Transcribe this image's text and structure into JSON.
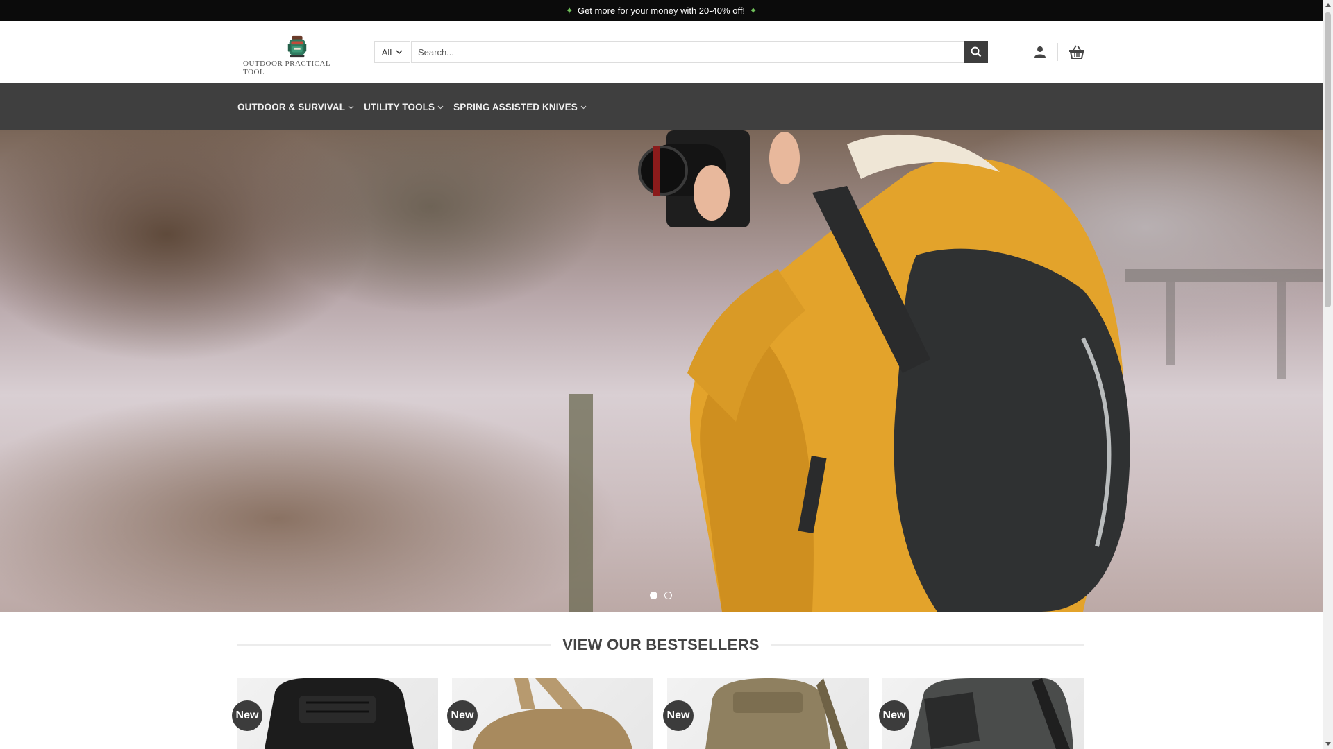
{
  "promo": {
    "icon": "money-wings-icon",
    "text": "Get more for your money with 20-40% off!"
  },
  "logo": {
    "text": "OUTDOOR PRACTICAL TOOL"
  },
  "search": {
    "category": "All",
    "placeholder": "Search...",
    "button_icon": "search-icon"
  },
  "header_icons": {
    "account": "account-icon",
    "cart": "basket-icon"
  },
  "nav": {
    "items": [
      {
        "label": "OUTDOOR & SURVIVAL"
      },
      {
        "label": "UTILITY TOOLS"
      },
      {
        "label": "SPRING ASSISTED KNIVES"
      }
    ]
  },
  "hero": {
    "slides_total": 2,
    "active_slide": 1,
    "image": "photographer in yellow jacket with backpack in snow"
  },
  "bestsellers": {
    "title": "VIEW OUR BESTSELLERS",
    "products": [
      {
        "badge": "New",
        "image": "black tactical sling bag"
      },
      {
        "badge": "New",
        "image": "tan sling shoulder bag"
      },
      {
        "badge": "New",
        "image": "khaki tactical backpack"
      },
      {
        "badge": "New",
        "image": "grey sling backpack"
      }
    ]
  },
  "colors": {
    "topbar": "#0b0b0b",
    "navbar": "#3f3f3f",
    "search_button": "#3d3d3d",
    "badge": "#3c3c3c",
    "jacket": "#e3a32b"
  }
}
